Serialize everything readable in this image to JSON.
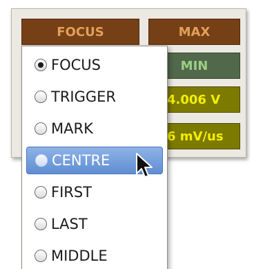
{
  "panel": {
    "focus_label": "FOCUS",
    "max_label": "MAX",
    "min_label": "MIN",
    "voltage_value": "4.006 V",
    "rate_value": "6 mV/us"
  },
  "menu": {
    "items": [
      {
        "label": "FOCUS",
        "checked": true
      },
      {
        "label": "TRIGGER",
        "checked": false
      },
      {
        "label": "MARK",
        "checked": false
      },
      {
        "label": "CENTRE",
        "checked": false,
        "hovered": true
      },
      {
        "label": "FIRST",
        "checked": false
      },
      {
        "label": "LAST",
        "checked": false
      },
      {
        "label": "MIDDLE",
        "checked": false
      }
    ]
  },
  "icons": {
    "cursor": "mouse-pointer-icon"
  }
}
